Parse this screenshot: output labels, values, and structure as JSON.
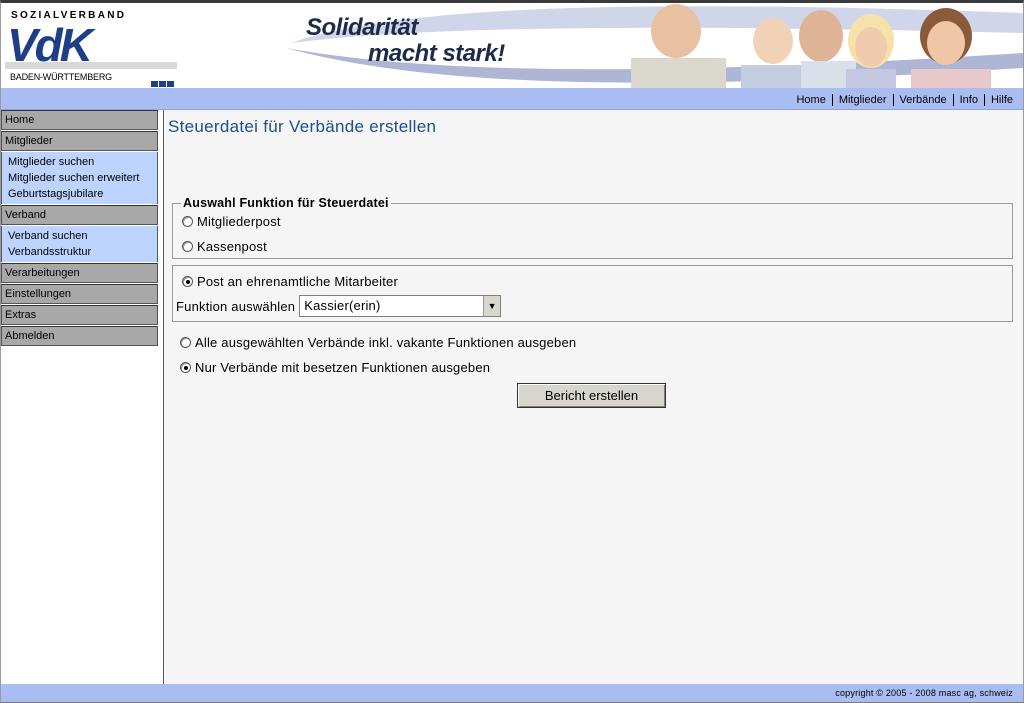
{
  "header": {
    "org_tag": "SOZIALVERBAND",
    "logo_text": "VdK",
    "region": "BADEN-WÜRTTEMBERG",
    "slogan_line1": "Solidarität",
    "slogan_line2": "macht stark!",
    "brand_color": "#1e3f86"
  },
  "top_nav": [
    "Home",
    "Mitglieder",
    "Verbände",
    "Info",
    "Hilfe"
  ],
  "sidebar": {
    "home": "Home",
    "mitglieder": "Mitglieder",
    "mitglieder_sub": [
      "Mitglieder suchen",
      "Mitglieder suchen erweitert",
      "Geburtstagsjubilare"
    ],
    "verband": "Verband",
    "verband_sub": [
      "Verband suchen",
      "Verbandsstruktur"
    ],
    "verarbeitungen": "Verarbeitungen",
    "einstellungen": "Einstellungen",
    "extras": "Extras",
    "abmelden": "Abmelden"
  },
  "main": {
    "title": "Steuerdatei für Verbände erstellen",
    "function_group": {
      "legend": "Auswahl Funktion für Steuerdatei",
      "options": [
        {
          "label": "Mitgliederpost",
          "checked": false
        },
        {
          "label": "Kassenpost",
          "checked": false
        }
      ]
    },
    "volunteer_group": {
      "option": {
        "label": "Post an ehrenamtliche Mitarbeiter",
        "checked": true
      },
      "select_label": "Funktion auswählen",
      "select_value": "Kassier(erin)"
    },
    "output_options": [
      {
        "label": "Alle ausgewählten Verbände inkl. vakante Funktionen ausgeben",
        "checked": false
      },
      {
        "label": "Nur Verbände mit besetzen Funktionen ausgeben",
        "checked": true
      }
    ],
    "report_button": "Bericht erstellen"
  },
  "footer": {
    "copyright": "copyright © 2005 - 2008 masc ag, schweiz"
  }
}
